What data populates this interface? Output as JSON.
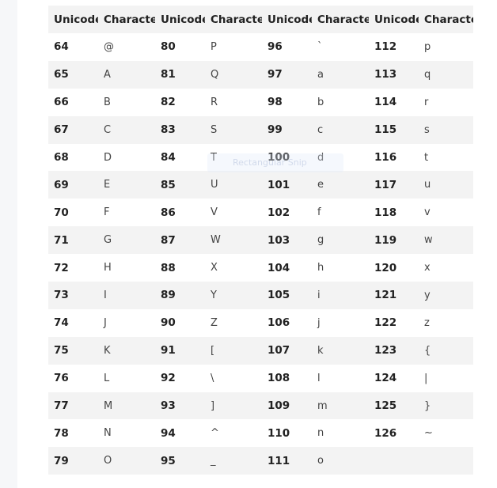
{
  "table": {
    "headers": [
      "Unicode",
      "Character",
      "Unicode",
      "Character",
      "Unicode",
      "Character",
      "Unicode",
      "Character"
    ],
    "rows": [
      [
        "64",
        "@",
        "80",
        "P",
        "96",
        "`",
        "112",
        "p"
      ],
      [
        "65",
        "A",
        "81",
        "Q",
        "97",
        "a",
        "113",
        "q"
      ],
      [
        "66",
        "B",
        "82",
        "R",
        "98",
        "b",
        "114",
        "r"
      ],
      [
        "67",
        "C",
        "83",
        "S",
        "99",
        "c",
        "115",
        "s"
      ],
      [
        "68",
        "D",
        "84",
        "T",
        "100",
        "d",
        "116",
        "t"
      ],
      [
        "69",
        "E",
        "85",
        "U",
        "101",
        "e",
        "117",
        "u"
      ],
      [
        "70",
        "F",
        "86",
        "V",
        "102",
        "f",
        "118",
        "v"
      ],
      [
        "71",
        "G",
        "87",
        "W",
        "103",
        "g",
        "119",
        "w"
      ],
      [
        "72",
        "H",
        "88",
        "X",
        "104",
        "h",
        "120",
        "x"
      ],
      [
        "73",
        "I",
        "89",
        "Y",
        "105",
        "i",
        "121",
        "y"
      ],
      [
        "74",
        "J",
        "90",
        "Z",
        "106",
        "j",
        "122",
        "z"
      ],
      [
        "75",
        "K",
        "91",
        "[",
        "107",
        "k",
        "123",
        "{"
      ],
      [
        "76",
        "L",
        "92",
        "\\",
        "108",
        "l",
        "124",
        "|"
      ],
      [
        "77",
        "M",
        "93",
        "]",
        "109",
        "m",
        "125",
        "}"
      ],
      [
        "78",
        "N",
        "94",
        "^",
        "110",
        "n",
        "126",
        "~"
      ],
      [
        "79",
        "O",
        "95",
        "_",
        "111",
        "o",
        "",
        ""
      ]
    ]
  },
  "overlay": {
    "watermark_text": "Rectangular Snip"
  }
}
